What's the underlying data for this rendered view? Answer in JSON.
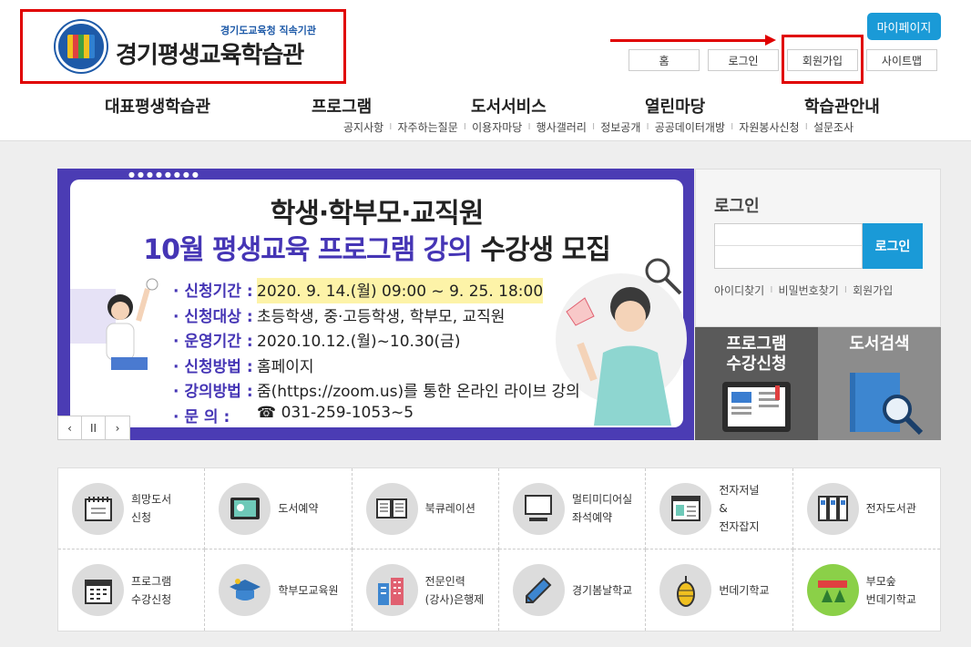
{
  "header": {
    "logo_sub": "경기도교육청 직속기관",
    "logo_title": "경기평생교육학습관",
    "mypage": "마이페이지",
    "top_links": [
      "홈",
      "로그인",
      "회원가입",
      "사이트맵"
    ],
    "gnb": [
      "대표평생학습관",
      "프로그램",
      "도서서비스",
      "열린마당",
      "학습관안내"
    ],
    "sub_nav": [
      "공지사항",
      "자주하는질문",
      "이용자마당",
      "행사갤러리",
      "정보공개",
      "공공데이터개방",
      "자원봉사신청",
      "설문조사"
    ]
  },
  "banner": {
    "title1": "학생·학부모·교직원",
    "title2_part1": "10월 평생교육 프로그램 강의",
    "title2_part2": "수강생 모집",
    "rows": [
      {
        "label": "· 신청기간 :",
        "value": "2020. 9. 14.(월) 09:00 ~ 9. 25. 18:00"
      },
      {
        "label": "· 신청대상 :",
        "value": "초등학생, 중·고등학생, 학부모, 교직원"
      },
      {
        "label": "· 운영기간 :",
        "value": "2020.10.12.(월)~10.30(금)"
      },
      {
        "label": "· 신청방법 :",
        "value": "홈페이지"
      },
      {
        "label": "· 강의방법 :",
        "value": "줌(https://zoom.us)를 통한 온라인 라이브 강의"
      },
      {
        "label": "· 문       의 :",
        "value": "☎ 031-259-1053~5"
      }
    ],
    "controls": [
      "‹",
      "II",
      "›"
    ]
  },
  "login": {
    "title": "로그인",
    "button": "로그인",
    "links": [
      "아이디찾기",
      "비밀번호찾기",
      "회원가입"
    ]
  },
  "quick": {
    "program": "프로그램\n수강신청",
    "book_search": "도서검색"
  },
  "grid": [
    {
      "label": "희망도서\n신청",
      "icon": "notebook-icon"
    },
    {
      "label": "도서예약",
      "icon": "tablet-icon"
    },
    {
      "label": "북큐레이션",
      "icon": "open-book-icon"
    },
    {
      "label": "멀티미디어실\n좌석예약",
      "icon": "computer-icon"
    },
    {
      "label": "전자저널\n&\n전자잡지",
      "icon": "window-icon"
    },
    {
      "label": "전자도서관",
      "icon": "binders-icon"
    },
    {
      "label": "프로그램\n수강신청",
      "icon": "calendar-icon"
    },
    {
      "label": "학부모교육원",
      "icon": "graduation-cap-icon"
    },
    {
      "label": "전문인력\n(강사)은행제",
      "icon": "building-icon"
    },
    {
      "label": "경기봄날학교",
      "icon": "pencil-icon"
    },
    {
      "label": "번데기학교",
      "icon": "cocoon-icon"
    },
    {
      "label": "부모숲\n번데기학교",
      "icon": "forest-logo-icon"
    }
  ]
}
